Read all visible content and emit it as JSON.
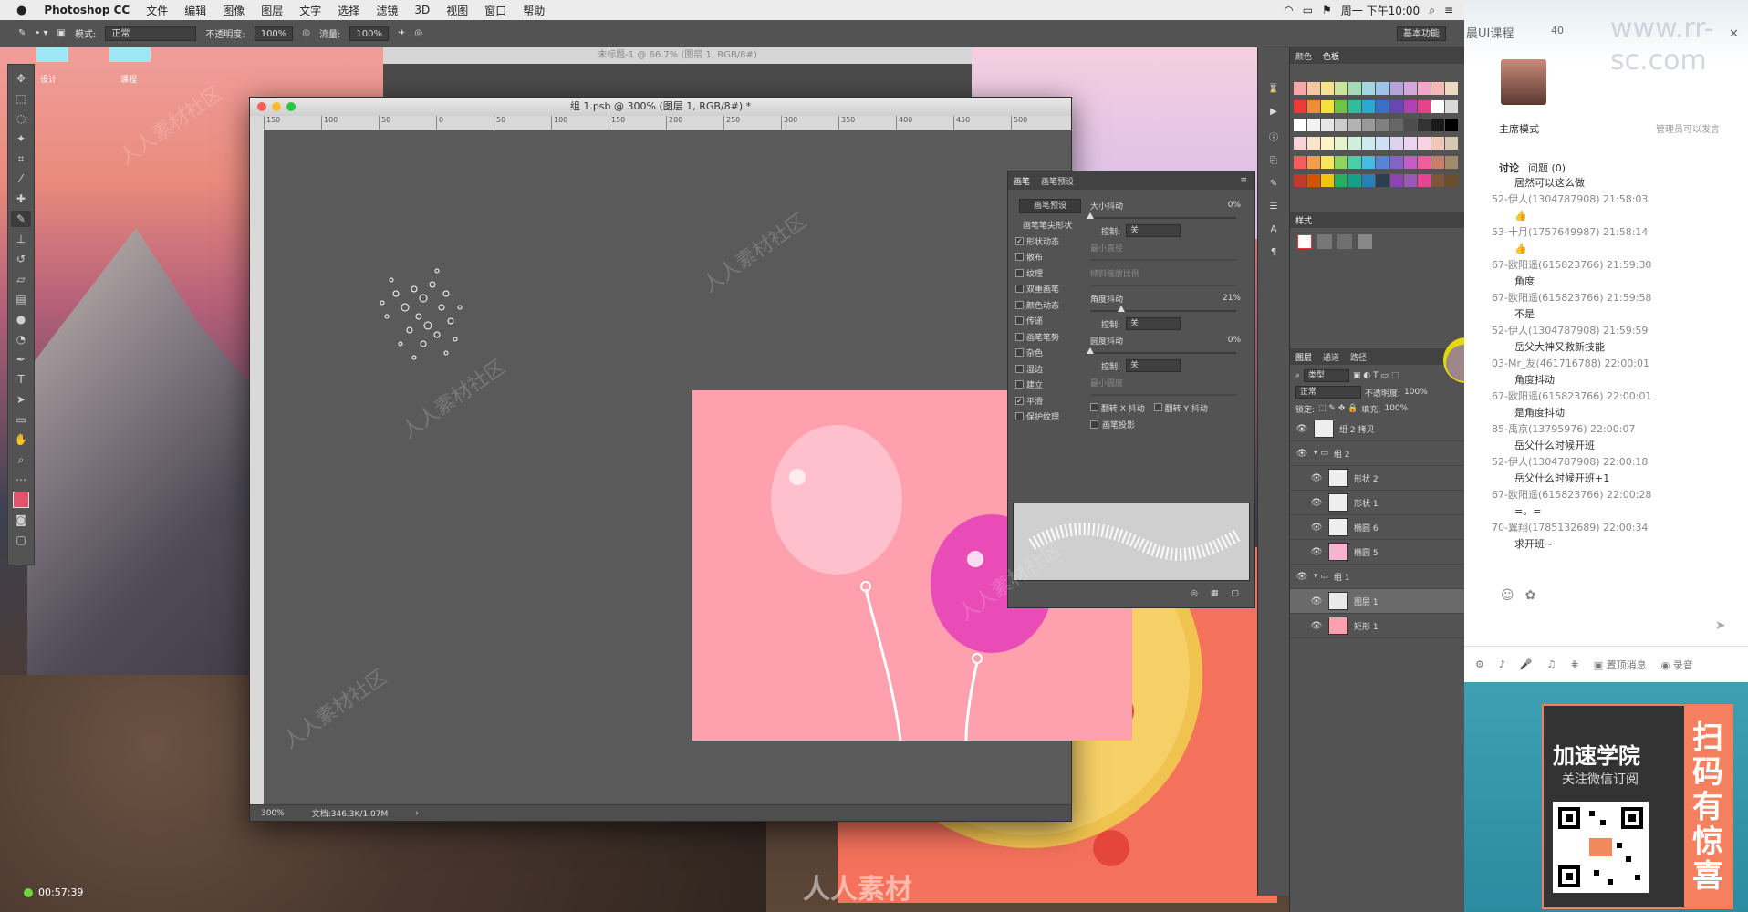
{
  "menubar": {
    "app": "Photoshop CC",
    "items": [
      "文件",
      "编辑",
      "图像",
      "图层",
      "文字",
      "选择",
      "滤镜",
      "3D",
      "视图",
      "窗口",
      "帮助"
    ],
    "clock": "周一 下午10:00"
  },
  "options": {
    "mode_label": "模式:",
    "mode_value": "正常",
    "opacity_label": "不透明度:",
    "opacity_value": "100%",
    "flow_label": "流量:",
    "flow_value": "100%",
    "workspace": "基本功能"
  },
  "desktop": {
    "label1": "设计",
    "label2": "课程"
  },
  "bgdoc": {
    "title": "未标题-1 @ 66.7% (图层 1, RGB/8#)"
  },
  "doc": {
    "title": "组 1.psb @ 300% (图层 1, RGB/8#) *",
    "ruler_ticks": [
      "150",
      "100",
      "50",
      "0",
      "50",
      "100",
      "150",
      "200",
      "250",
      "300",
      "350",
      "400",
      "450",
      "500"
    ],
    "zoom": "300%",
    "fileinfo": "文档:346.3K/1.07M"
  },
  "brush": {
    "tabs": [
      "画笔",
      "画笔预设"
    ],
    "preset_btn": "画笔预设",
    "tip_label": "画笔笔尖形状",
    "options": [
      {
        "label": "形状动态",
        "checked": true
      },
      {
        "label": "散布",
        "checked": false
      },
      {
        "label": "纹理",
        "checked": false
      },
      {
        "label": "双重画笔",
        "checked": false
      },
      {
        "label": "颜色动态",
        "checked": false
      },
      {
        "label": "传递",
        "checked": false
      },
      {
        "label": "画笔笔势",
        "checked": false
      },
      {
        "label": "杂色",
        "checked": false
      },
      {
        "label": "湿边",
        "checked": false
      },
      {
        "label": "建立",
        "checked": false
      },
      {
        "label": "平滑",
        "checked": true
      },
      {
        "label": "保护纹理",
        "checked": false
      }
    ],
    "size_jitter": "大小抖动",
    "size_jitter_val": "0%",
    "control": "控制:",
    "control_val": "关",
    "min_diameter": "最小直径",
    "tilt_scale": "倾斜缩放比例",
    "angle_jitter": "角度抖动",
    "angle_jitter_val": "21%",
    "round_jitter": "圆度抖动",
    "round_jitter_val": "0%",
    "min_round": "最小圆度",
    "flip_x": "翻转 X 抖动",
    "flip_y": "翻转 Y 抖动",
    "brush_proj": "画笔投影"
  },
  "swatches": {
    "tabs": [
      "颜色",
      "色板"
    ],
    "colors": [
      "#f7a7a5",
      "#f6c6a1",
      "#f8e08e",
      "#c9e59d",
      "#a3dcb4",
      "#9fd8de",
      "#9ec3ea",
      "#b3a4de",
      "#d7a6de",
      "#f4a6c9",
      "#f2b8b1",
      "#eed8bf",
      "#ea3b3a",
      "#f08b35",
      "#f6e03b",
      "#70c348",
      "#2fbd9b",
      "#27aad7",
      "#3a6fc6",
      "#6846b5",
      "#b140b4",
      "#e5428b",
      "#ffffff",
      "#d9d9d9",
      "#ffffff",
      "#f2f2f2",
      "#e6e6e6",
      "#cccccc",
      "#b3b3b3",
      "#999999",
      "#808080",
      "#666666",
      "#4d4d4d",
      "#333333",
      "#1a1a1a",
      "#000000",
      "#f7d2d6",
      "#fbe3c9",
      "#fdf3c4",
      "#e4f2cd",
      "#cfeedc",
      "#cdebef",
      "#cfe0f6",
      "#dcd3f0",
      "#ecd3f0",
      "#f8d3e4",
      "#f1c8b8",
      "#d6c7b3",
      "#f25e5e",
      "#f79b4c",
      "#f9e55b",
      "#8fd460",
      "#4acfa9",
      "#43bde5",
      "#5685d8",
      "#8562c8",
      "#c45dc6",
      "#ef5d9f",
      "#c97d6b",
      "#a38a6b",
      "#c0392b",
      "#d35400",
      "#f1c40f",
      "#27ae60",
      "#16a085",
      "#2980b9",
      "#2c3e50",
      "#8e44ad",
      "#9b59b6",
      "#e84393",
      "#7f5539",
      "#6b4f2a"
    ]
  },
  "styles": {
    "tab": "样式"
  },
  "layers": {
    "tabs": [
      "图层",
      "通道",
      "路径"
    ],
    "kind": "类型",
    "blend": "正常",
    "opacity_label": "不透明度:",
    "opacity_val": "100%",
    "lock_label": "锁定:",
    "fill_label": "填充:",
    "fill_val": "100%",
    "items": [
      {
        "name": "组 2 拷贝",
        "indent": 0,
        "selected": false,
        "thumb": "#ffffff"
      },
      {
        "name": "组 2",
        "indent": 0,
        "selected": false,
        "thumb": "folder"
      },
      {
        "name": "形状 2",
        "indent": 1,
        "selected": false,
        "thumb": "#ffffff"
      },
      {
        "name": "形状 1",
        "indent": 1,
        "selected": false,
        "thumb": "#ffffff"
      },
      {
        "name": "椭圆 6",
        "indent": 1,
        "selected": false,
        "thumb": "#ffffff"
      },
      {
        "name": "椭圆 5",
        "indent": 1,
        "selected": false,
        "thumb": "#f6b4d0"
      },
      {
        "name": "组 1",
        "indent": 0,
        "selected": false,
        "thumb": "folder"
      },
      {
        "name": "图层 1",
        "indent": 1,
        "selected": true,
        "thumb": "#e9e9e9"
      },
      {
        "name": "矩形 1",
        "indent": 1,
        "selected": false,
        "thumb": "#fea0ae"
      }
    ]
  },
  "chat": {
    "title": "晨UI课程",
    "count": "40",
    "mode": "主席模式",
    "admin_note": "管理员可以发言",
    "tab_discuss": "讨论",
    "tab_question": "问题",
    "question_count": "(0)",
    "messages": [
      {
        "meta": "",
        "msg": "居然可以这么做"
      },
      {
        "meta": "52-伊人(1304787908) 21:58:03",
        "msg": "👍"
      },
      {
        "meta": "53-十月(1757649987) 21:58:14",
        "msg": "👍"
      },
      {
        "meta": "67-欧阳遥(615823766) 21:59:30",
        "msg": "角度"
      },
      {
        "meta": "67-欧阳遥(615823766) 21:59:58",
        "msg": "不是"
      },
      {
        "meta": "52-伊人(1304787908) 21:59:59",
        "msg": "岳父大神又救新技能"
      },
      {
        "meta": "03-Mr_友(461716788) 22:00:01",
        "msg": "角度抖动"
      },
      {
        "meta": "67-欧阳遥(615823766) 22:00:01",
        "msg": "是角度抖动"
      },
      {
        "meta": "85-禹京(13795976) 22:00:07",
        "msg": "岳父什么时候开班"
      },
      {
        "meta": "52-伊人(1304787908) 22:00:18",
        "msg": "岳父什么时候开班+1"
      },
      {
        "meta": "67-欧阳遥(615823766) 22:00:28",
        "msg": "=。="
      },
      {
        "meta": "70-翼翔(1785132689) 22:00:34",
        "msg": "求开班~"
      }
    ],
    "bar_items": [
      "置顶消息",
      "录音"
    ],
    "promo_line1": "加速学院",
    "promo_line2": "关注微信订阅",
    "promo_side": [
      "扫",
      "码",
      "有",
      "惊",
      "喜"
    ]
  },
  "recording": {
    "time": "00:57:39"
  },
  "watermarks": {
    "center": "人人素材",
    "tile": "人人素材社区",
    "url": "www.rr-sc.com"
  }
}
